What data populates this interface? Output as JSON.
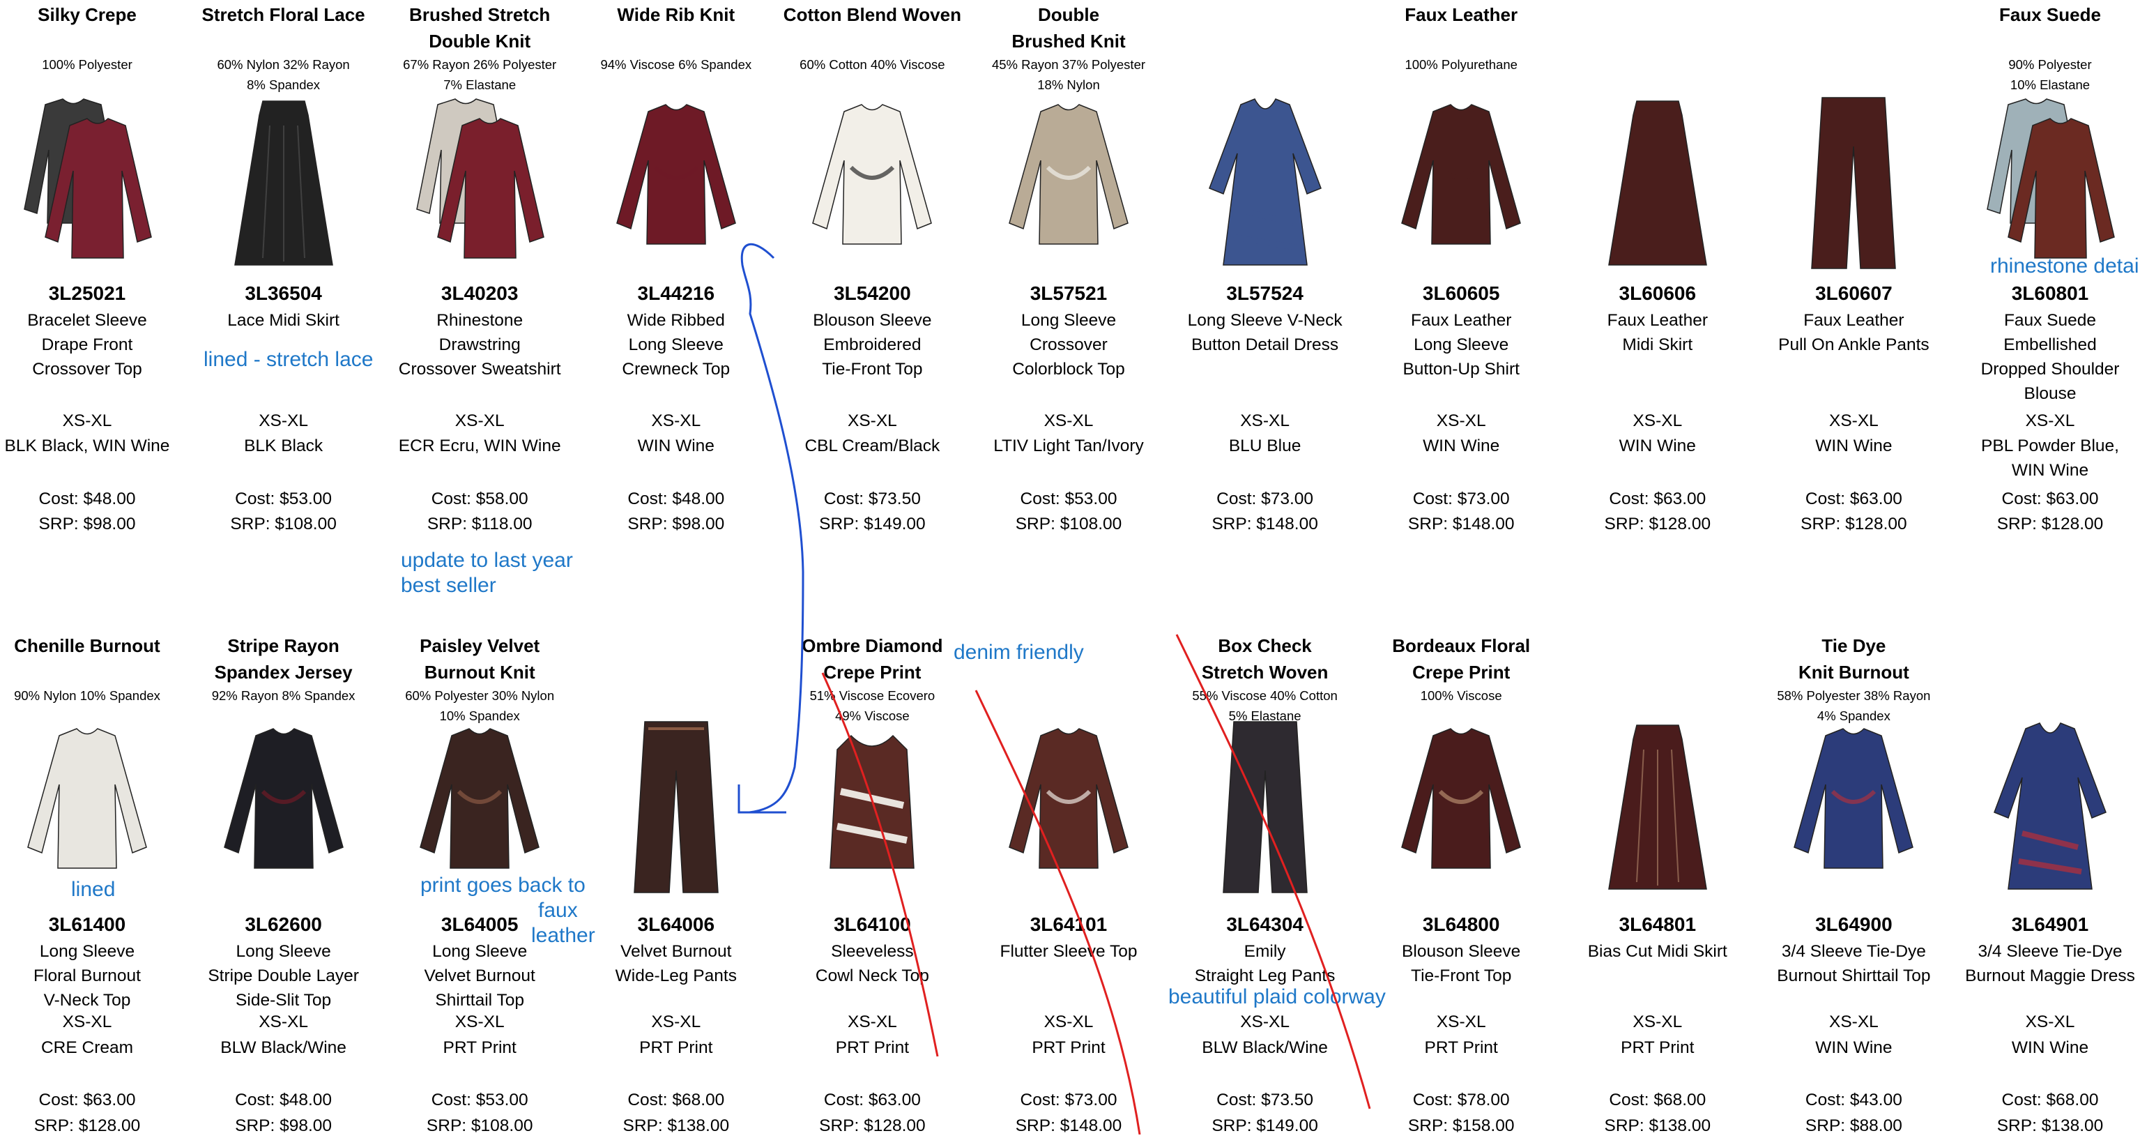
{
  "rows": [
    {
      "items": [
        {
          "fabric": [
            "Silky Crepe"
          ],
          "content": [
            "100% Polyester"
          ],
          "style": "3L25021",
          "desc": [
            "Bracelet Sleeve",
            "Drape Front",
            "Crossover Top"
          ],
          "sizes": "XS-XL",
          "colors": [
            "BLK Black, WIN Wine"
          ],
          "cost": "Cost: $48.00",
          "srp": "SRP: $98.00",
          "garment": "double-top",
          "swatch": [
            "#3a3a3a",
            "#7a2030"
          ]
        },
        {
          "fabric": [
            "Stretch Floral Lace"
          ],
          "content": [
            "60% Nylon 32% Rayon",
            "8% Spandex"
          ],
          "style": "3L36504",
          "desc": [
            "Lace Midi Skirt"
          ],
          "sizes": "XS-XL",
          "colors": [
            "BLK Black"
          ],
          "cost": "Cost: $53.00",
          "srp": "SRP: $108.00",
          "garment": "skirt",
          "swatch": [
            "#222222",
            "#555555"
          ]
        },
        {
          "fabric": [
            "Brushed Stretch",
            "Double Knit"
          ],
          "content": [
            "67% Rayon 26% Polyester",
            "7% Elastane"
          ],
          "style": "3L40203",
          "desc": [
            "Rhinestone",
            "Drawstring",
            "Crossover Sweatshirt"
          ],
          "sizes": "XS-XL",
          "colors": [
            "ECR Ecru, WIN Wine"
          ],
          "cost": "Cost: $58.00",
          "srp": "SRP: $118.00",
          "garment": "double-top",
          "swatch": [
            "#cfc9c0",
            "#7a1f2c"
          ]
        },
        {
          "fabric": [
            "Wide Rib Knit"
          ],
          "content": [
            "94% Viscose 6% Spandex"
          ],
          "style": "3L44216",
          "desc": [
            "Wide Ribbed",
            "Long Sleeve",
            "Crewneck Top"
          ],
          "sizes": "XS-XL",
          "colors": [
            "WIN Wine"
          ],
          "cost": "Cost: $48.00",
          "srp": "SRP: $98.00",
          "garment": "top",
          "swatch": [
            "#6e1a26",
            "#6e1a26"
          ]
        },
        {
          "fabric": [
            "Cotton Blend Woven"
          ],
          "content": [
            "60% Cotton 40% Viscose"
          ],
          "style": "3L54200",
          "desc": [
            "Blouson Sleeve",
            "Embroidered",
            "Tie-Front Top"
          ],
          "sizes": "XS-XL",
          "colors": [
            "CBL Cream/Black"
          ],
          "cost": "Cost: $73.50",
          "srp": "SRP: $149.00",
          "garment": "top",
          "swatch": [
            "#f2efe8",
            "#2a2a2a"
          ]
        },
        {
          "fabric": [
            "Double",
            "Brushed Knit"
          ],
          "content": [
            "45% Rayon 37% Polyester",
            "18% Nylon"
          ],
          "style": "3L57521",
          "desc": [
            "Long Sleeve",
            "Crossover",
            "Colorblock Top"
          ],
          "sizes": "XS-XL",
          "colors": [
            "LTIV Light Tan/Ivory"
          ],
          "cost": "Cost: $53.00",
          "srp": "SRP: $108.00",
          "garment": "top",
          "swatch": [
            "#b9ab96",
            "#f1efe9"
          ]
        },
        {
          "fabric": [],
          "content": [],
          "style": "3L57524",
          "desc": [
            "Long Sleeve V-Neck",
            "Button Detail Dress"
          ],
          "sizes": "XS-XL",
          "colors": [
            "BLU Blue"
          ],
          "cost": "Cost: $73.00",
          "srp": "SRP: $148.00",
          "garment": "dress",
          "swatch": [
            "#3c5590",
            "#3c5590"
          ]
        },
        {
          "fabric": [
            "Faux Leather"
          ],
          "content": [
            "100% Polyurethane"
          ],
          "style": "3L60605",
          "desc": [
            "Faux Leather",
            "Long Sleeve",
            "Button-Up Shirt"
          ],
          "sizes": "XS-XL",
          "colors": [
            "WIN Wine"
          ],
          "cost": "Cost: $73.00",
          "srp": "SRP: $148.00",
          "garment": "top",
          "swatch": [
            "#4a1e1c",
            "#4a1e1c"
          ]
        },
        {
          "fabric": [],
          "content": [],
          "style": "3L60606",
          "desc": [
            "Faux Leather",
            "Midi Skirt"
          ],
          "sizes": "XS-XL",
          "colors": [
            "WIN Wine"
          ],
          "cost": "Cost: $63.00",
          "srp": "SRP: $128.00",
          "garment": "skirt",
          "swatch": [
            "#4a1e1c",
            "#4a1e1c"
          ]
        },
        {
          "fabric": [],
          "content": [],
          "style": "3L60607",
          "desc": [
            "Faux Leather",
            "Pull On Ankle Pants"
          ],
          "sizes": "XS-XL",
          "colors": [
            "WIN Wine"
          ],
          "cost": "Cost: $63.00",
          "srp": "SRP: $128.00",
          "garment": "pants",
          "swatch": [
            "#4a1e1c",
            "#4a1e1c"
          ]
        },
        {
          "fabric": [
            "Faux Suede"
          ],
          "content": [
            "90% Polyester",
            "10% Elastane"
          ],
          "style": "3L60801",
          "desc": [
            "Faux Suede",
            "Embellished",
            "Dropped Shoulder",
            "Blouse"
          ],
          "sizes": "XS-XL",
          "colors": [
            "PBL Powder Blue,",
            "WIN Wine"
          ],
          "cost": "Cost: $63.00",
          "srp": "SRP: $128.00",
          "garment": "double-top",
          "swatch": [
            "#9fb1b8",
            "#6b2a22"
          ]
        }
      ]
    },
    {
      "items": [
        {
          "fabric": [
            "Chenille Burnout"
          ],
          "content": [
            "90% Nylon 10% Spandex"
          ],
          "style": "3L61400",
          "desc": [
            "Long Sleeve",
            "Floral Burnout",
            "V-Neck Top"
          ],
          "sizes": "XS-XL",
          "colors": [
            "CRE Cream"
          ],
          "cost": "Cost: $63.00",
          "srp": "SRP: $128.00",
          "garment": "top",
          "swatch": [
            "#e8e6e0",
            "#e8e6e0"
          ]
        },
        {
          "fabric": [
            "Stripe Rayon",
            "Spandex Jersey"
          ],
          "content": [
            "92% Rayon 8% Spandex"
          ],
          "style": "3L62600",
          "desc": [
            "Long Sleeve",
            "Stripe Double Layer",
            "Side-Slit Top"
          ],
          "sizes": "XS-XL",
          "colors": [
            "BLW Black/Wine"
          ],
          "cost": "Cost: $48.00",
          "srp": "SRP: $98.00",
          "garment": "top",
          "swatch": [
            "#1e1e24",
            "#6e1a26"
          ]
        },
        {
          "fabric": [
            "Paisley Velvet",
            "Burnout Knit"
          ],
          "content": [
            "60% Polyester 30% Nylon",
            "10% Spandex"
          ],
          "style": "3L64005",
          "desc": [
            "Long Sleeve",
            "Velvet Burnout",
            "Shirttail Top"
          ],
          "sizes": "XS-XL",
          "colors": [
            "PRT Print"
          ],
          "cost": "Cost: $53.00",
          "srp": "SRP: $108.00",
          "garment": "top",
          "swatch": [
            "#3a2420",
            "#8a5a44"
          ]
        },
        {
          "fabric": [],
          "content": [],
          "style": "3L64006",
          "desc": [
            "Velvet Burnout",
            "Wide-Leg Pants"
          ],
          "sizes": "XS-XL",
          "colors": [
            "PRT Print"
          ],
          "cost": "Cost: $68.00",
          "srp": "SRP: $138.00",
          "garment": "pants",
          "swatch": [
            "#3a2420",
            "#8a5a44"
          ]
        },
        {
          "fabric": [
            "Ombre Diamond",
            "Crepe Print"
          ],
          "content": [
            "51% Viscose Ecovero",
            "49% Viscose"
          ],
          "style": "3L64100",
          "desc": [
            "Sleeveless",
            "Cowl Neck Top"
          ],
          "sizes": "XS-XL",
          "colors": [
            "PRT Print"
          ],
          "cost": "Cost: $63.00",
          "srp": "SRP: $128.00",
          "garment": "tank",
          "swatch": [
            "#5a2a24",
            "#e9e4de"
          ]
        },
        {
          "fabric": [],
          "content": [],
          "style": "3L64101",
          "desc": [
            "Flutter Sleeve Top"
          ],
          "sizes": "XS-XL",
          "colors": [
            "PRT Print"
          ],
          "cost": "Cost: $73.00",
          "srp": "SRP: $148.00",
          "garment": "top",
          "swatch": [
            "#5a2a24",
            "#e9e4de"
          ]
        },
        {
          "fabric": [
            "Box Check",
            "Stretch Woven"
          ],
          "content": [
            "55% Viscose 40% Cotton",
            "5% Elastane"
          ],
          "style": "3L64304",
          "desc": [
            "Emily",
            "Straight Leg Pants"
          ],
          "sizes": "XS-XL",
          "colors": [
            "BLW Black/Wine"
          ],
          "cost": "Cost: $73.50",
          "srp": "SRP: $149.00",
          "garment": "pants",
          "swatch": [
            "#2e2a30",
            "#2e2a30"
          ]
        },
        {
          "fabric": [
            "Bordeaux Floral",
            "Crepe Print"
          ],
          "content": [
            "100% Viscose"
          ],
          "style": "3L64800",
          "desc": [
            "Blouson Sleeve",
            "Tie-Front Top"
          ],
          "sizes": "XS-XL",
          "colors": [
            "PRT Print"
          ],
          "cost": "Cost: $78.00",
          "srp": "SRP: $158.00",
          "garment": "top",
          "swatch": [
            "#4a1c1c",
            "#b48a6c"
          ]
        },
        {
          "fabric": [],
          "content": [],
          "style": "3L64801",
          "desc": [
            "Bias Cut Midi Skirt"
          ],
          "sizes": "XS-XL",
          "colors": [
            "PRT Print"
          ],
          "cost": "Cost: $68.00",
          "srp": "SRP: $138.00",
          "garment": "skirt",
          "swatch": [
            "#4a1c1c",
            "#b48a6c"
          ]
        },
        {
          "fabric": [
            "Tie Dye",
            "Knit Burnout"
          ],
          "content": [
            "58% Polyester 38% Rayon",
            "4% Spandex"
          ],
          "style": "3L64900",
          "desc": [
            "3/4 Sleeve Tie-Dye",
            "Burnout Shirttail Top"
          ],
          "sizes": "XS-XL",
          "colors": [
            "WIN Wine"
          ],
          "cost": "Cost: $43.00",
          "srp": "SRP: $88.00",
          "garment": "top",
          "swatch": [
            "#2c3c7a",
            "#a83040"
          ]
        },
        {
          "fabric": [],
          "content": [],
          "style": "3L64901",
          "desc": [
            "3/4 Sleeve Tie-Dye",
            "Burnout Maggie Dress"
          ],
          "sizes": "XS-XL",
          "colors": [
            "WIN Wine"
          ],
          "cost": "Cost: $68.00",
          "srp": "SRP: $138.00",
          "garment": "dress",
          "swatch": [
            "#2c3c7a",
            "#a83040"
          ]
        }
      ]
    }
  ],
  "notes": [
    {
      "text": "rhinestone detail"
    },
    {
      "text": "lined - stretch lace"
    },
    {
      "text": "update to last year"
    },
    {
      "text": "best seller"
    },
    {
      "text": "denim friendly"
    },
    {
      "text": "lined"
    },
    {
      "text": "print goes back to"
    },
    {
      "text": "faux"
    },
    {
      "text": "leather"
    },
    {
      "text": "beautiful plaid colorway"
    }
  ],
  "colors": {
    "note_blue": "#1f78c8",
    "strike_red": "#e02020"
  }
}
